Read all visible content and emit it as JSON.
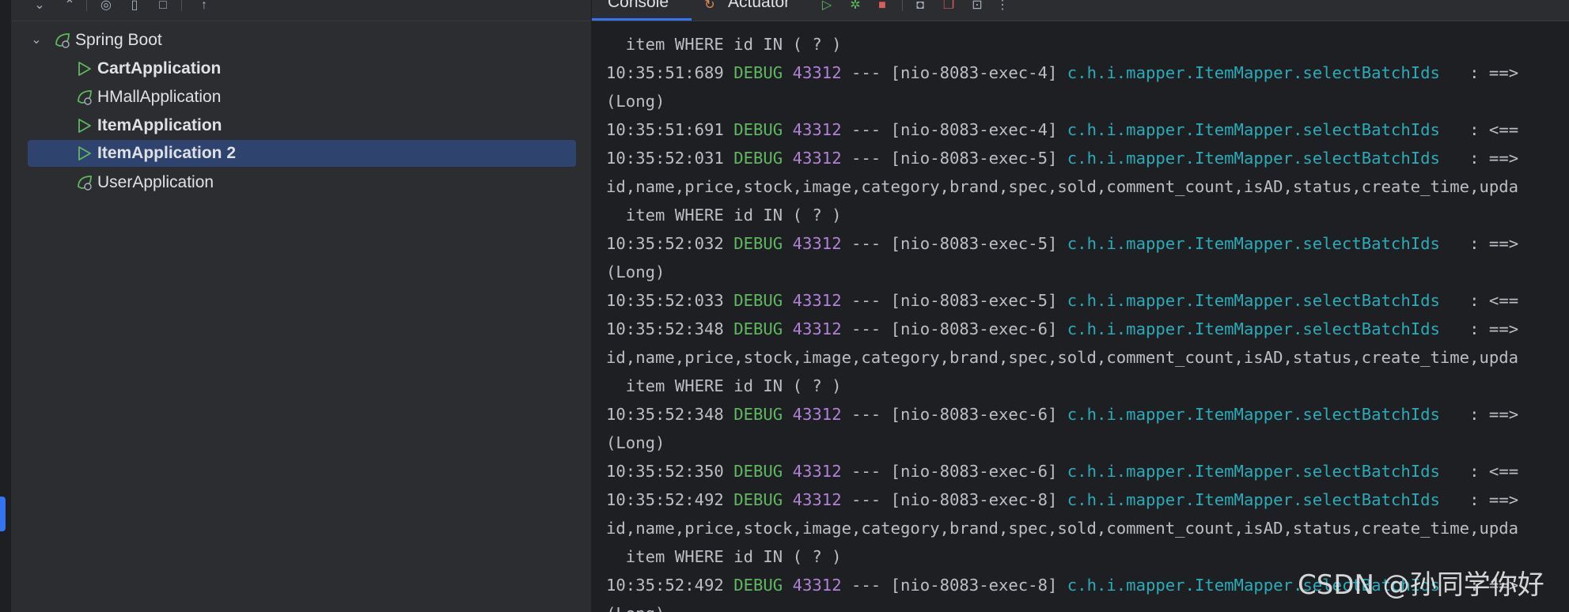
{
  "tree": {
    "root_label": "Spring Boot",
    "items": [
      {
        "label": "CartApplication",
        "bold": true,
        "icon": "run-triangle-icon",
        "selected": false
      },
      {
        "label": "HMallApplication",
        "bold": false,
        "icon": "spring-boot-leaf-icon",
        "selected": false
      },
      {
        "label": "ItemApplication",
        "bold": true,
        "icon": "run-triangle-icon",
        "selected": false
      },
      {
        "label": "ItemApplication 2",
        "bold": true,
        "icon": "run-triangle-icon",
        "selected": true
      },
      {
        "label": "UserApplication",
        "bold": false,
        "icon": "spring-boot-leaf-icon",
        "selected": false
      }
    ]
  },
  "console": {
    "tabs": [
      "Console",
      "Actuator"
    ],
    "lines": [
      {
        "kind": "cont",
        "text": "  item WHERE id IN ( ? )"
      },
      {
        "kind": "log",
        "time": "10:35:51:689",
        "level": "DEBUG",
        "pid": "43312",
        "thread": " --- [nio-8083-exec-4] ",
        "logger": "c.h.i.mapper.ItemMapper.selectBatchIds",
        "msg": "   : ==>"
      },
      {
        "kind": "cont",
        "text": "(Long)"
      },
      {
        "kind": "log",
        "time": "10:35:51:691",
        "level": "DEBUG",
        "pid": "43312",
        "thread": " --- [nio-8083-exec-4] ",
        "logger": "c.h.i.mapper.ItemMapper.selectBatchIds",
        "msg": "   : <=="
      },
      {
        "kind": "log",
        "time": "10:35:52:031",
        "level": "DEBUG",
        "pid": "43312",
        "thread": " --- [nio-8083-exec-5] ",
        "logger": "c.h.i.mapper.ItemMapper.selectBatchIds",
        "msg": "   : ==>"
      },
      {
        "kind": "cont",
        "text": "id,name,price,stock,image,category,brand,spec,sold,comment_count,isAD,status,create_time,upda"
      },
      {
        "kind": "cont",
        "text": "  item WHERE id IN ( ? )"
      },
      {
        "kind": "log",
        "time": "10:35:52:032",
        "level": "DEBUG",
        "pid": "43312",
        "thread": " --- [nio-8083-exec-5] ",
        "logger": "c.h.i.mapper.ItemMapper.selectBatchIds",
        "msg": "   : ==>"
      },
      {
        "kind": "cont",
        "text": "(Long)"
      },
      {
        "kind": "log",
        "time": "10:35:52:033",
        "level": "DEBUG",
        "pid": "43312",
        "thread": " --- [nio-8083-exec-5] ",
        "logger": "c.h.i.mapper.ItemMapper.selectBatchIds",
        "msg": "   : <=="
      },
      {
        "kind": "log",
        "time": "10:35:52:348",
        "level": "DEBUG",
        "pid": "43312",
        "thread": " --- [nio-8083-exec-6] ",
        "logger": "c.h.i.mapper.ItemMapper.selectBatchIds",
        "msg": "   : ==>"
      },
      {
        "kind": "cont",
        "text": "id,name,price,stock,image,category,brand,spec,sold,comment_count,isAD,status,create_time,upda"
      },
      {
        "kind": "cont",
        "text": "  item WHERE id IN ( ? )"
      },
      {
        "kind": "log",
        "time": "10:35:52:348",
        "level": "DEBUG",
        "pid": "43312",
        "thread": " --- [nio-8083-exec-6] ",
        "logger": "c.h.i.mapper.ItemMapper.selectBatchIds",
        "msg": "   : ==>"
      },
      {
        "kind": "cont",
        "text": "(Long)"
      },
      {
        "kind": "log",
        "time": "10:35:52:350",
        "level": "DEBUG",
        "pid": "43312",
        "thread": " --- [nio-8083-exec-6] ",
        "logger": "c.h.i.mapper.ItemMapper.selectBatchIds",
        "msg": "   : <=="
      },
      {
        "kind": "log",
        "time": "10:35:52:492",
        "level": "DEBUG",
        "pid": "43312",
        "thread": " --- [nio-8083-exec-8] ",
        "logger": "c.h.i.mapper.ItemMapper.selectBatchIds",
        "msg": "   : ==>"
      },
      {
        "kind": "cont",
        "text": "id,name,price,stock,image,category,brand,spec,sold,comment_count,isAD,status,create_time,upda"
      },
      {
        "kind": "cont",
        "text": "  item WHERE id IN ( ? )"
      },
      {
        "kind": "log",
        "time": "10:35:52:492",
        "level": "DEBUG",
        "pid": "43312",
        "thread": " --- [nio-8083-exec-8] ",
        "logger": "c.h.i.mapper.ItemMapper.selectBatchIds",
        "msg": "   : ==>"
      },
      {
        "kind": "cont",
        "text": "(Long)"
      }
    ]
  },
  "watermark": "CSDN @孙同学你好",
  "colors": {
    "accent": "#3574f0",
    "selection": "#2e436e",
    "debug_level": "#5fb85f",
    "pid": "#b180d7",
    "logger": "#2aacb8",
    "run_icon": "#5fb85f",
    "stop_icon": "#db5c5c"
  }
}
